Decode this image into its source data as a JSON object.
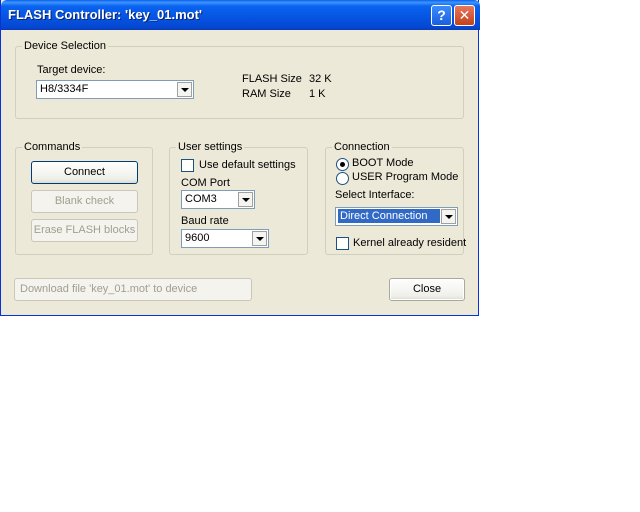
{
  "window": {
    "title": "FLASH Controller: 'key_01.mot'"
  },
  "device_selection": {
    "legend": "Device Selection",
    "target_label": "Target device:",
    "target_value": "H8/3334F",
    "flash_size_label": "FLASH Size",
    "flash_size_value": "32 K",
    "ram_size_label": "RAM Size",
    "ram_size_value": "1 K"
  },
  "commands": {
    "legend": "Commands",
    "connect": "Connect",
    "blank_check": "Blank check",
    "erase": "Erase FLASH blocks"
  },
  "user_settings": {
    "legend": "User settings",
    "use_default": "Use default settings",
    "use_default_checked": false,
    "com_port_label": "COM Port",
    "com_port_value": "COM3",
    "baud_rate_label": "Baud rate",
    "baud_rate_value": "9600"
  },
  "connection": {
    "legend": "Connection",
    "boot_mode": "BOOT Mode",
    "user_mode": "USER Program Mode",
    "selected_mode": "BOOT Mode",
    "interface_label": "Select Interface:",
    "interface_value": "Direct Connection",
    "kernel_resident": "Kernel already resident",
    "kernel_resident_checked": false
  },
  "footer": {
    "download": "Download file 'key_01.mot' to device",
    "close": "Close"
  }
}
